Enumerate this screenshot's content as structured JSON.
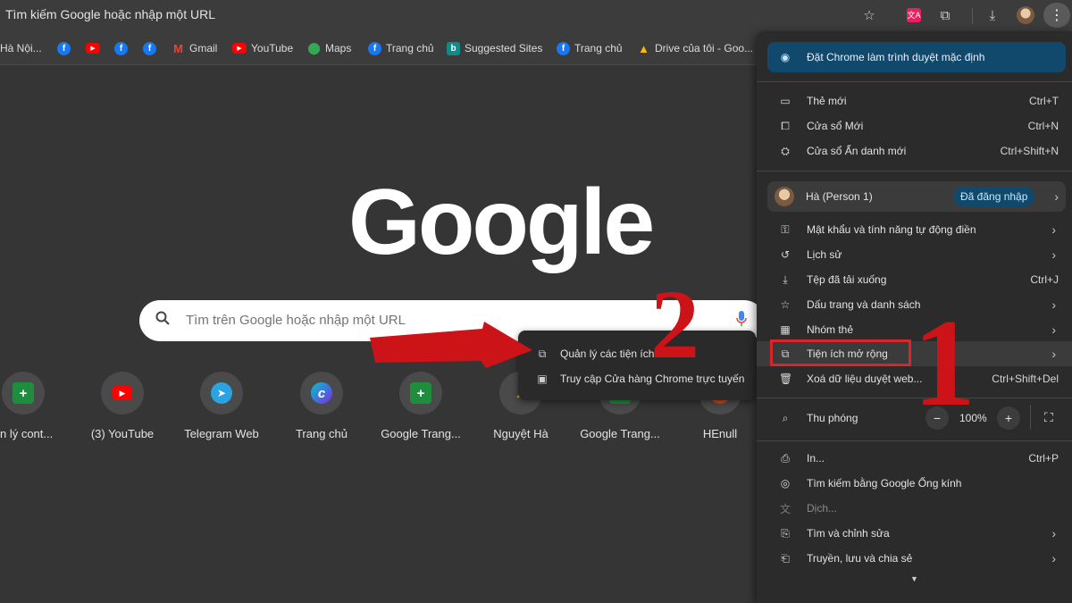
{
  "omnibox": {
    "text": "Tìm kiếm Google hoặc nhập một URL"
  },
  "toolbar": {
    "icons": [
      "star-icon",
      "translate-icon",
      "extensions-icon",
      "download-icon",
      "avatar",
      "menu-icon"
    ]
  },
  "bookmarks": [
    {
      "label": "Hà Nội...",
      "icon": "none"
    },
    {
      "label": "",
      "icon": "facebook"
    },
    {
      "label": "",
      "icon": "youtube"
    },
    {
      "label": "",
      "icon": "facebook"
    },
    {
      "label": "",
      "icon": "facebook"
    },
    {
      "label": "Gmail",
      "icon": "gmail"
    },
    {
      "label": "YouTube",
      "icon": "youtube"
    },
    {
      "label": "Maps",
      "icon": "maps"
    },
    {
      "label": "Trang chủ",
      "icon": "facebook"
    },
    {
      "label": "Suggested Sites",
      "icon": "bing"
    },
    {
      "label": "Trang chủ",
      "icon": "facebook"
    },
    {
      "label": "Drive của tôi - Goo...",
      "icon": "drive"
    }
  ],
  "logo": {
    "text": "Google"
  },
  "search": {
    "placeholder": "Tìm trên Google hoặc nhập một URL"
  },
  "shortcuts": [
    {
      "label": "ản lý cont...",
      "icon": "sheets"
    },
    {
      "label": "(3) YouTube",
      "icon": "youtube"
    },
    {
      "label": "Telegram Web",
      "icon": "telegram"
    },
    {
      "label": "Trang chủ",
      "icon": "canva"
    },
    {
      "label": "Google Trang...",
      "icon": "sheets"
    },
    {
      "label": "Nguyệt Hà",
      "icon": "drive"
    },
    {
      "label": "Google Trang...",
      "icon": "sheets"
    },
    {
      "label": "HEnull",
      "icon": "generic"
    }
  ],
  "submenu": {
    "items": [
      {
        "label": "Quản lý các tiện ích",
        "icon": "extensions-icon"
      },
      {
        "label": "Truy cập Cửa hàng Chrome trực tuyến",
        "icon": "store-icon"
      }
    ]
  },
  "menu": {
    "default_banner": "Đặt Chrome làm trình duyệt mặc định",
    "new_tab": {
      "label": "Thẻ mới",
      "shortcut": "Ctrl+T"
    },
    "new_window": {
      "label": "Cửa sổ Mới",
      "shortcut": "Ctrl+N"
    },
    "incognito": {
      "label": "Cửa sổ Ẩn danh mới",
      "shortcut": "Ctrl+Shift+N"
    },
    "profile": {
      "name": "Hà (Person 1)",
      "badge": "Đã đăng nhập"
    },
    "passwords": {
      "label": "Mật khẩu và tính năng tự động điền"
    },
    "history": {
      "label": "Lịch sử"
    },
    "downloads": {
      "label": "Tệp đã tải xuống",
      "shortcut": "Ctrl+J"
    },
    "bookmarks": {
      "label": "Dấu trang và danh sách"
    },
    "tab_groups": {
      "label": "Nhóm thẻ"
    },
    "extensions": {
      "label": "Tiện ích mở rộng"
    },
    "clear_data": {
      "label": "Xoá dữ liệu duyệt web...",
      "shortcut": "Ctrl+Shift+Del"
    },
    "zoom": {
      "label": "Thu phóng",
      "minus": "−",
      "value": "100%",
      "plus": "+"
    },
    "print": {
      "label": "In...",
      "shortcut": "Ctrl+P"
    },
    "lens": {
      "label": "Tìm kiếm bằng Google Ống kính"
    },
    "translate": {
      "label": "Dịch..."
    },
    "find_edit": {
      "label": "Tìm và chỉnh sửa"
    },
    "cast_save_share": {
      "label": "Truyền, lưu và chia sẻ"
    }
  },
  "annotations": {
    "step1": "1",
    "step2": "2"
  },
  "colors": {
    "annotation_red": "#d8262b",
    "banner_blue": "#10496b",
    "accent_light": "#c2e7ff"
  }
}
